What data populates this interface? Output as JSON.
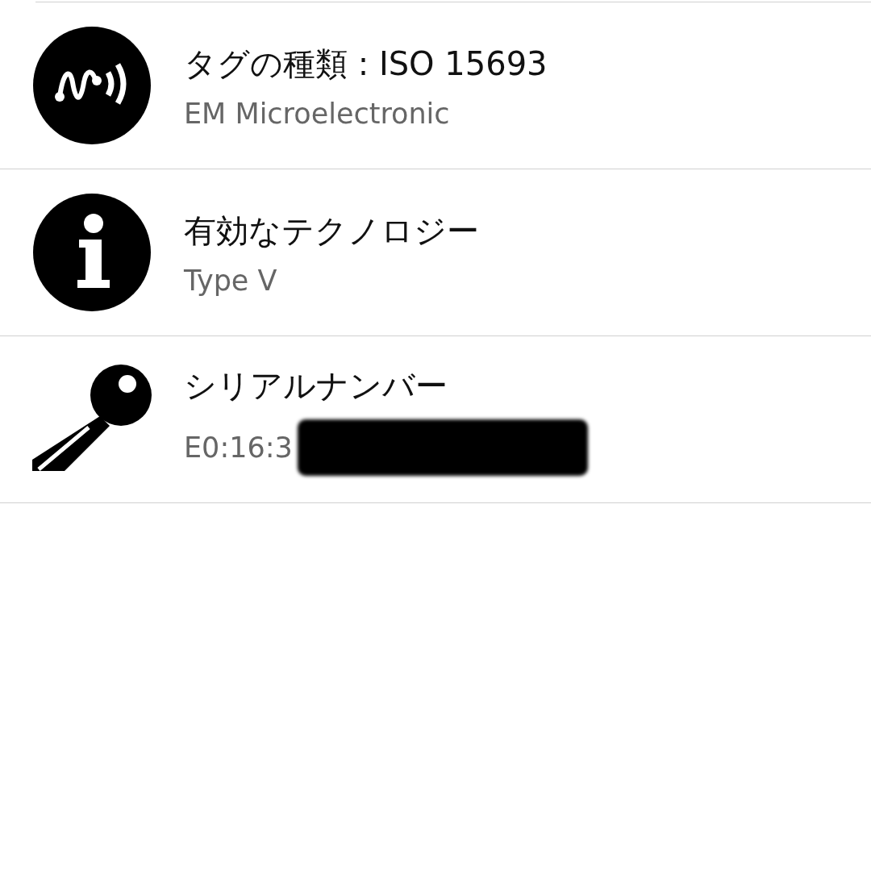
{
  "rows": [
    {
      "kind": "nfc",
      "title": "タグの種類 : ISO 15693",
      "value": "EM Microelectronic"
    },
    {
      "kind": "info",
      "title": "有効なテクノロジー",
      "value": "Type V"
    },
    {
      "kind": "key",
      "title": "シリアルナンバー",
      "value": "E0:16:3",
      "redacted": true
    }
  ]
}
